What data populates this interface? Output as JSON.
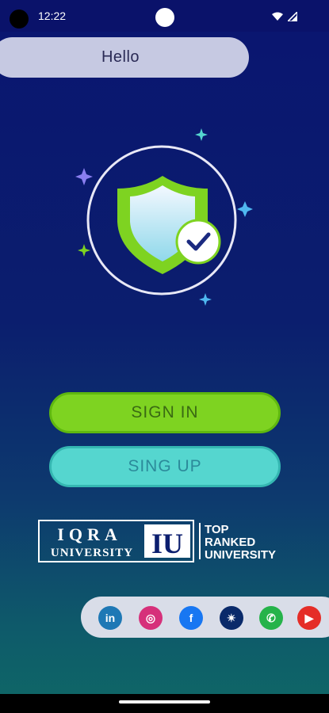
{
  "status_bar": {
    "time": "12:22",
    "icons": [
      "wifi-icon",
      "signal-icon"
    ]
  },
  "greeting": {
    "text": "Hello"
  },
  "hero": {
    "icon": "shield-check-icon"
  },
  "buttons": {
    "sign_in": "SIGN IN",
    "sign_up": "SING UP"
  },
  "logo": {
    "line1": "IQRA",
    "line2": "UNIVERSITY",
    "monogram": "IU",
    "tag1": "TOP",
    "tag2": "RANKED",
    "tag3": "UNIVERSITY"
  },
  "social": [
    {
      "name": "linkedin",
      "glyph": "in",
      "color": "#1e78b5"
    },
    {
      "name": "instagram",
      "glyph": "◎",
      "color": "#d6307a"
    },
    {
      "name": "facebook",
      "glyph": "f",
      "color": "#1877f2"
    },
    {
      "name": "app",
      "glyph": "✴",
      "color": "#0a2a6a"
    },
    {
      "name": "whatsapp",
      "glyph": "✆",
      "color": "#25b34a"
    },
    {
      "name": "youtube",
      "glyph": "▶",
      "color": "#e52d27"
    }
  ],
  "colors": {
    "primary_green": "#7ed321",
    "teal": "#55d6cf",
    "background_top": "#0a1570",
    "background_bottom": "#0f6866"
  }
}
